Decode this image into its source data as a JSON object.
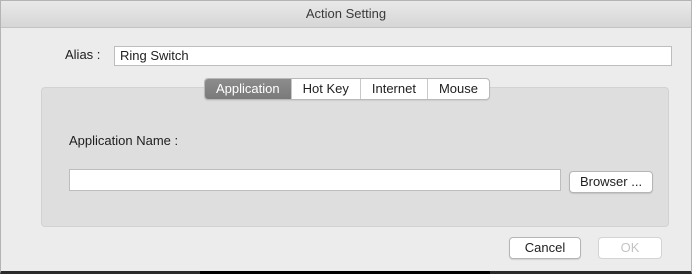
{
  "window": {
    "title": "Action Setting"
  },
  "alias": {
    "label": "Alias :",
    "value": "Ring Switch"
  },
  "tabs": [
    {
      "label": "Application",
      "active": true
    },
    {
      "label": "Hot Key",
      "active": false
    },
    {
      "label": "Internet",
      "active": false
    },
    {
      "label": "Mouse",
      "active": false
    }
  ],
  "application": {
    "name_label": "Application Name :",
    "name_value": "",
    "browse_label": "Browser ..."
  },
  "buttons": {
    "cancel": "Cancel",
    "ok": "OK"
  }
}
